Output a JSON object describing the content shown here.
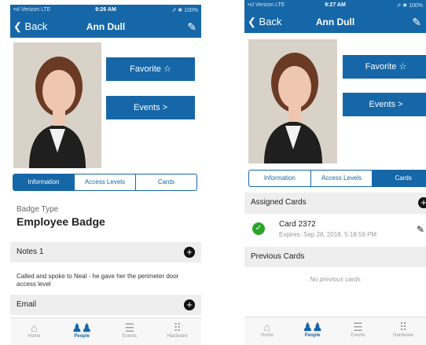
{
  "left": {
    "status": {
      "carrier": "•ııl Verizon  LTE",
      "time": "9:26 AM",
      "battery": "⇗ ✱ 100%"
    },
    "nav": {
      "back": "Back",
      "title": "Ann Dull"
    },
    "favorite": "Favorite ☆",
    "events": "Events >",
    "tabs": [
      "Information",
      "Access Levels",
      "Cards"
    ],
    "badge_type_label": "Badge Type",
    "badge_type_value": "Employee Badge",
    "notes_title": "Notes 1",
    "notes_text": "Called and spoke to Neal - he gave her the perimeter door access level",
    "email_title": "Email",
    "tabbar": [
      "Home",
      "People",
      "Events",
      "Hardware"
    ]
  },
  "right": {
    "status": {
      "carrier": "•ııl Verizon  LTE",
      "time": "9:27 AM",
      "battery": "⇗ ✱ 100%"
    },
    "nav": {
      "back": "Back",
      "title": "Ann Dull"
    },
    "favorite": "Favorite ☆",
    "events": "Events >",
    "tabs": [
      "Information",
      "Access Levels",
      "Cards"
    ],
    "assigned_title": "Assigned Cards",
    "card_name": "Card 2372",
    "card_expires": "Expires: Sep 28, 2018, 5:18:59 PM",
    "previous_title": "Previous Cards",
    "no_previous": "No previous cards",
    "tabbar": [
      "Home",
      "People",
      "Events",
      "Hardware"
    ]
  },
  "colors": {
    "accent": "#1667a8",
    "success": "#2aa52a"
  },
  "icons": {
    "home": "home-icon",
    "people": "people-icon",
    "events": "list-icon",
    "hardware": "grid-icon",
    "edit": "edit-icon"
  }
}
